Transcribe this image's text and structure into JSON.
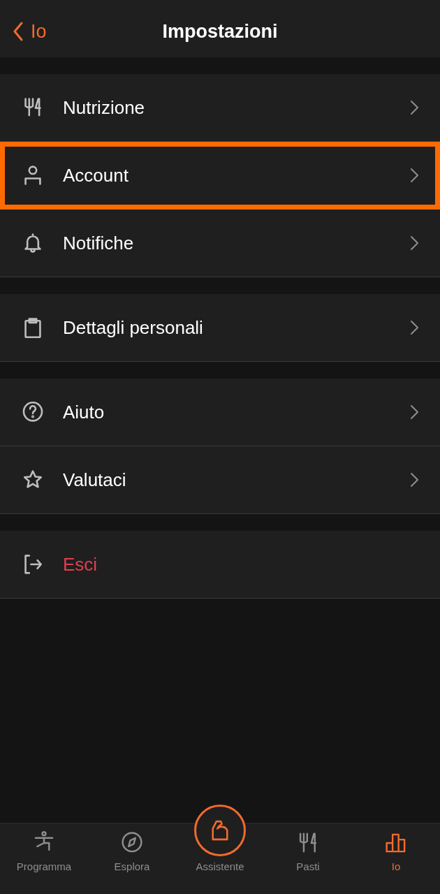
{
  "header": {
    "back_label": "Io",
    "title": "Impostazioni"
  },
  "groups": [
    {
      "items": [
        {
          "label": "Nutrizione",
          "kind": "link",
          "highlighted": false
        },
        {
          "label": "Account",
          "kind": "link",
          "highlighted": true
        },
        {
          "label": "Notifiche",
          "kind": "link",
          "highlighted": false
        }
      ]
    },
    {
      "items": [
        {
          "label": "Dettagli personali",
          "kind": "link",
          "highlighted": false
        }
      ]
    },
    {
      "items": [
        {
          "label": "Aiuto",
          "kind": "link",
          "highlighted": false
        },
        {
          "label": "Valutaci",
          "kind": "link",
          "highlighted": false
        }
      ]
    },
    {
      "items": [
        {
          "label": "Esci",
          "kind": "danger",
          "highlighted": false
        }
      ]
    }
  ],
  "tab_bar": [
    {
      "label": "Programma",
      "kind": "tab",
      "selected": false
    },
    {
      "label": "Esplora",
      "kind": "tab",
      "selected": false
    },
    {
      "label": "Assistente",
      "kind": "center",
      "selected": false
    },
    {
      "label": "Pasti",
      "kind": "tab",
      "selected": false
    },
    {
      "label": "Io",
      "kind": "tab",
      "selected": true
    }
  ]
}
